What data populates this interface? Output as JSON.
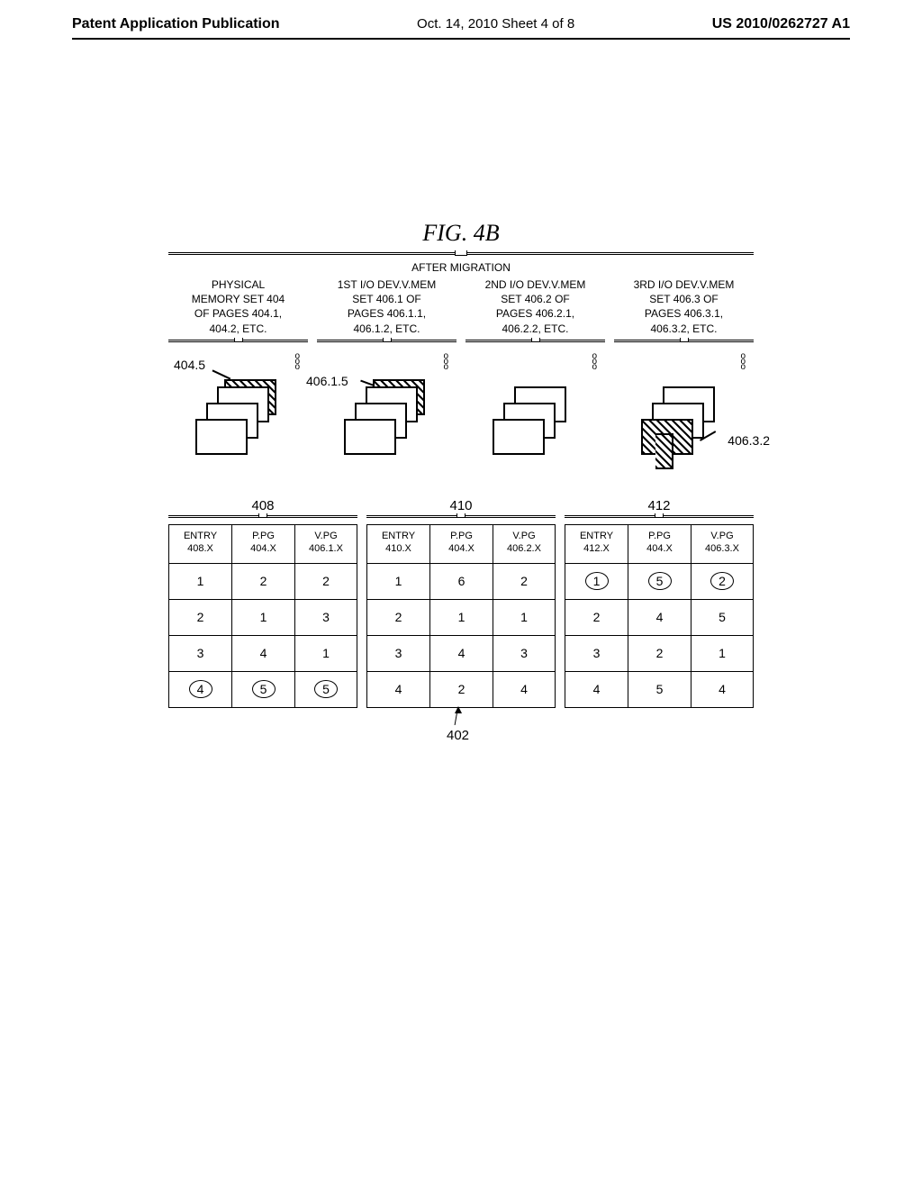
{
  "header": {
    "left": "Patent Application Publication",
    "mid": "Oct. 14, 2010  Sheet 4 of 8",
    "right": "US 2010/0262727 A1"
  },
  "figure_title": "FIG. 4B",
  "banner": "AFTER MIGRATION",
  "columns": [
    {
      "head": "PHYSICAL\nMEMORY SET 404\nOF PAGES 404.1,\n404.2, ETC."
    },
    {
      "head": "1ST I/O DEV.V.MEM\nSET 406.1 OF\nPAGES 406.1.1,\n406.1.2, ETC."
    },
    {
      "head": "2ND I/O DEV.V.MEM\nSET 406.2 OF\nPAGES 406.2.1,\n406.2.2, ETC."
    },
    {
      "head": "3RD I/O DEV.V.MEM\nSET 406.3 OF\nPAGES 406.3.1,\n406.3.2, ETC."
    }
  ],
  "labels": {
    "a": "404.5",
    "b": "406.1.5",
    "c": "406.3.2",
    "t408": "408",
    "t410": "410",
    "t412": "412",
    "t402": "402"
  },
  "tables": {
    "t408": {
      "headers": [
        "ENTRY\n408.X",
        "P.PG\n404.X",
        "V.PG\n406.1.X"
      ],
      "rows": [
        [
          {
            "v": "1"
          },
          {
            "v": "2"
          },
          {
            "v": "2"
          }
        ],
        [
          {
            "v": "2"
          },
          {
            "v": "1"
          },
          {
            "v": "3"
          }
        ],
        [
          {
            "v": "3"
          },
          {
            "v": "4"
          },
          {
            "v": "1"
          }
        ],
        [
          {
            "v": "4",
            "c": true
          },
          {
            "v": "5",
            "c": true
          },
          {
            "v": "5",
            "c": true
          }
        ]
      ]
    },
    "t410": {
      "headers": [
        "ENTRY\n410.X",
        "P.PG\n404.X",
        "V.PG\n406.2.X"
      ],
      "rows": [
        [
          {
            "v": "1"
          },
          {
            "v": "6"
          },
          {
            "v": "2"
          }
        ],
        [
          {
            "v": "2"
          },
          {
            "v": "1"
          },
          {
            "v": "1"
          }
        ],
        [
          {
            "v": "3"
          },
          {
            "v": "4"
          },
          {
            "v": "3"
          }
        ],
        [
          {
            "v": "4"
          },
          {
            "v": "2"
          },
          {
            "v": "4"
          }
        ]
      ]
    },
    "t412": {
      "headers": [
        "ENTRY\n412.X",
        "P.PG\n404.X",
        "V.PG\n406.3.X"
      ],
      "rows": [
        [
          {
            "v": "1",
            "c": true
          },
          {
            "v": "5",
            "c": true
          },
          {
            "v": "2",
            "c": true
          }
        ],
        [
          {
            "v": "2"
          },
          {
            "v": "4"
          },
          {
            "v": "5"
          }
        ],
        [
          {
            "v": "3"
          },
          {
            "v": "2"
          },
          {
            "v": "1"
          }
        ],
        [
          {
            "v": "4"
          },
          {
            "v": "5"
          },
          {
            "v": "4"
          }
        ]
      ]
    }
  }
}
